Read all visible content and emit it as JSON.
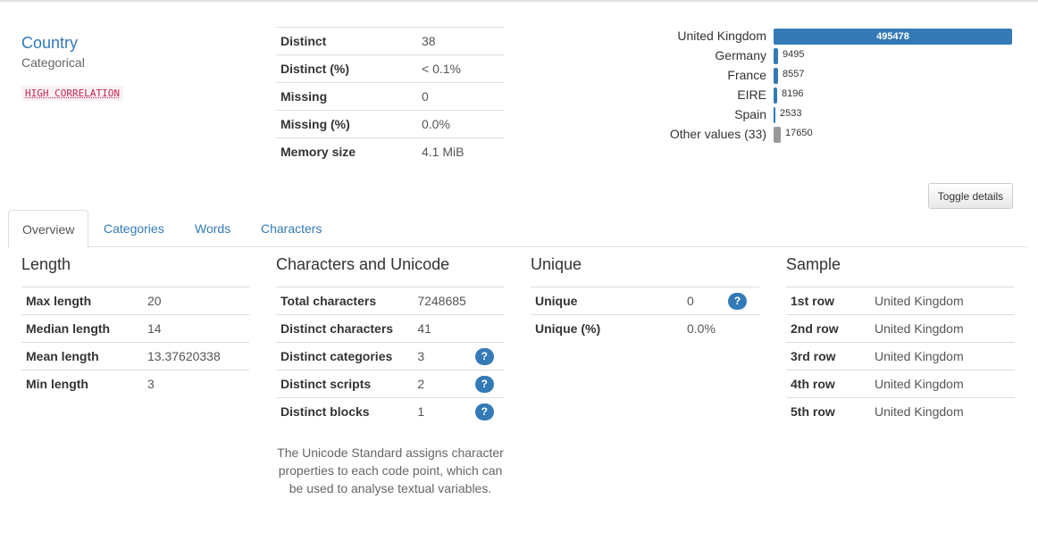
{
  "variable": {
    "name": "Country",
    "type": "Categorical",
    "warning": "HIGH CORRELATION"
  },
  "stats": [
    {
      "label": "Distinct",
      "value": "38"
    },
    {
      "label": "Distinct (%)",
      "value": "< 0.1%"
    },
    {
      "label": "Missing",
      "value": "0"
    },
    {
      "label": "Missing (%)",
      "value": "0.0%"
    },
    {
      "label": "Memory size",
      "value": "4.1 MiB"
    }
  ],
  "frequencies": [
    {
      "label": "United Kingdom",
      "count": "495478",
      "value": 495478
    },
    {
      "label": "Germany",
      "count": "9495",
      "value": 9495
    },
    {
      "label": "France",
      "count": "8557",
      "value": 8557
    },
    {
      "label": "EIRE",
      "count": "8196",
      "value": 8196
    },
    {
      "label": "Spain",
      "count": "2533",
      "value": 2533
    },
    {
      "label": "Other values (33)",
      "count": "17650",
      "value": 17650
    }
  ],
  "toggle_label": "Toggle details",
  "tabs": [
    "Overview",
    "Categories",
    "Words",
    "Characters"
  ],
  "length": {
    "title": "Length",
    "rows": [
      {
        "label": "Max length",
        "value": "20"
      },
      {
        "label": "Median length",
        "value": "14"
      },
      {
        "label": "Mean length",
        "value": "13.37620338"
      },
      {
        "label": "Min length",
        "value": "3"
      }
    ]
  },
  "unicode": {
    "title": "Characters and Unicode",
    "rows": [
      {
        "label": "Total characters",
        "value": "7248685"
      },
      {
        "label": "Distinct characters",
        "value": "41"
      },
      {
        "label": "Distinct categories",
        "value": "3"
      },
      {
        "label": "Distinct scripts",
        "value": "2"
      },
      {
        "label": "Distinct blocks",
        "value": "1"
      }
    ],
    "note": "The Unicode Standard assigns character properties to each code point, which can be used to analyse textual variables."
  },
  "unique": {
    "title": "Unique",
    "rows": [
      {
        "label": "Unique",
        "value": "0"
      },
      {
        "label": "Unique (%)",
        "value": "0.0%"
      }
    ]
  },
  "sample": {
    "title": "Sample",
    "rows": [
      {
        "label": "1st row",
        "value": "United Kingdom"
      },
      {
        "label": "2nd row",
        "value": "United Kingdom"
      },
      {
        "label": "3rd row",
        "value": "United Kingdom"
      },
      {
        "label": "4th row",
        "value": "United Kingdom"
      },
      {
        "label": "5th row",
        "value": "United Kingdom"
      }
    ]
  },
  "help_glyph": "?"
}
